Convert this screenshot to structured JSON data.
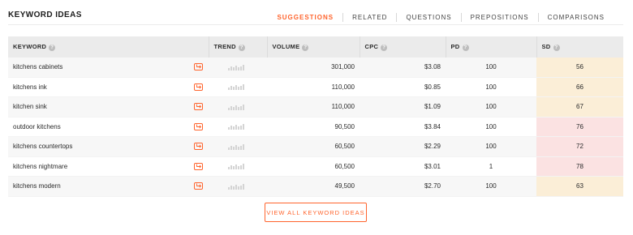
{
  "title": "KEYWORD IDEAS",
  "tabs": [
    {
      "label": "SUGGESTIONS",
      "active": true
    },
    {
      "label": "RELATED",
      "active": false
    },
    {
      "label": "QUESTIONS",
      "active": false
    },
    {
      "label": "PREPOSITIONS",
      "active": false
    },
    {
      "label": "COMPARISONS",
      "active": false
    }
  ],
  "columns": {
    "keyword": "KEYWORD",
    "trend": "TREND",
    "volume": "VOLUME",
    "cpc": "CPC",
    "pd": "PD",
    "sd": "SD"
  },
  "rows": [
    {
      "keyword": "kitchens cabinets",
      "volume": "301,000",
      "cpc": "$3.08",
      "pd": "100",
      "sd": "56",
      "sd_level": "yellow"
    },
    {
      "keyword": "kitchens ink",
      "volume": "110,000",
      "cpc": "$0.85",
      "pd": "100",
      "sd": "66",
      "sd_level": "yellow"
    },
    {
      "keyword": "kitchen sink",
      "volume": "110,000",
      "cpc": "$1.09",
      "pd": "100",
      "sd": "67",
      "sd_level": "yellow"
    },
    {
      "keyword": "outdoor kitchens",
      "volume": "90,500",
      "cpc": "$3.84",
      "pd": "100",
      "sd": "76",
      "sd_level": "pink"
    },
    {
      "keyword": "kitchens countertops",
      "volume": "60,500",
      "cpc": "$2.29",
      "pd": "100",
      "sd": "72",
      "sd_level": "pink"
    },
    {
      "keyword": "kitchens nightmare",
      "volume": "60,500",
      "cpc": "$3.01",
      "pd": "1",
      "sd": "78",
      "sd_level": "pink"
    },
    {
      "keyword": "kitchens modern",
      "volume": "49,500",
      "cpc": "$2.70",
      "pd": "100",
      "sd": "63",
      "sd_level": "yellow"
    }
  ],
  "view_all_label": "VIEW ALL KEYWORD IDEAS",
  "colors": {
    "accent": "#ff642d",
    "sd_yellow": "#fbeed7",
    "sd_pink": "#fbe2e2",
    "header_bg": "#ebebeb"
  }
}
